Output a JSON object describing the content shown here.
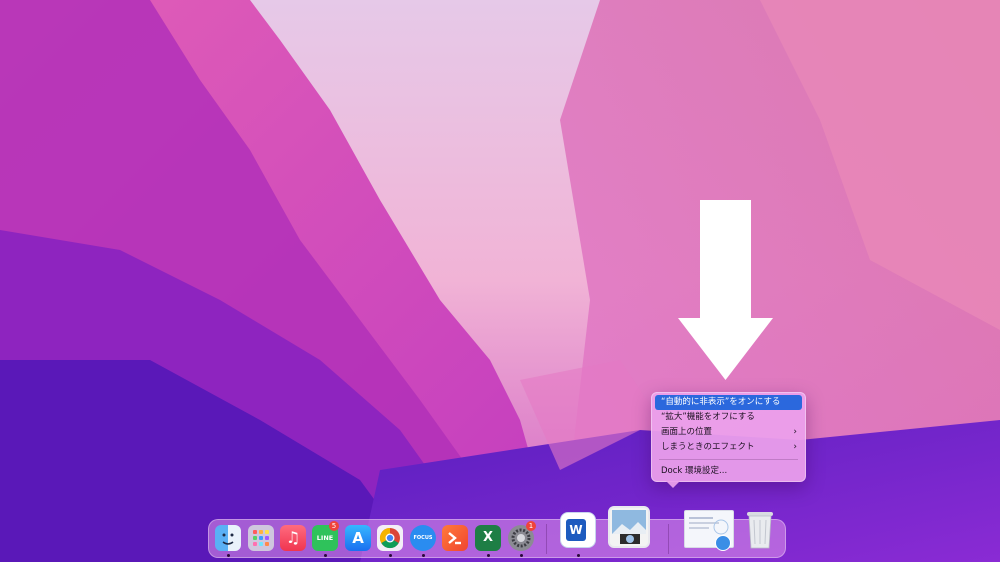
{
  "context_menu": {
    "items": [
      {
        "label": "“自動的に非表示”をオンにする",
        "highlighted": true
      },
      {
        "label": "“拡大”機能をオフにする"
      },
      {
        "label": "画面上の位置",
        "submenu": true
      },
      {
        "label": "しまうときのエフェクト",
        "submenu": true
      },
      {
        "label": "Dock 環境設定..."
      }
    ],
    "submenu_glyph": "›"
  },
  "dock": {
    "apps": [
      {
        "name": "Finder",
        "icon": "finder-icon",
        "running": true
      },
      {
        "name": "Launchpad",
        "icon": "launchpad-icon"
      },
      {
        "name": "Music",
        "icon": "music-icon",
        "glyph": "♫"
      },
      {
        "name": "LINE",
        "icon": "line-icon",
        "text": "LINE",
        "badge": "5",
        "running": true
      },
      {
        "name": "App Store",
        "icon": "app-store-icon",
        "glyph": "A"
      },
      {
        "name": "Chrome",
        "icon": "chrome-icon",
        "running": true
      },
      {
        "name": "Focus",
        "icon": "focus-icon",
        "text": "FOCUS",
        "running": true
      },
      {
        "name": "Prompt",
        "icon": "prompt-icon"
      },
      {
        "name": "Excel",
        "icon": "excel-icon",
        "text": "X",
        "running": true
      },
      {
        "name": "System Preferences",
        "icon": "system-preferences-icon",
        "badge": "1",
        "running": true
      },
      {
        "name": "Word",
        "icon": "word-icon",
        "text": "W",
        "running": true
      },
      {
        "name": "Preview",
        "icon": "preview-icon"
      },
      {
        "name": "Downloads folder",
        "icon": "folder-stack-icon"
      },
      {
        "name": "Trash",
        "icon": "trash-icon"
      }
    ]
  },
  "annotation": {
    "icon": "down-arrow-icon",
    "color": "#ffffff"
  },
  "colors": {
    "menu_highlight": "#2b68dd",
    "badge": "#f0433a"
  }
}
